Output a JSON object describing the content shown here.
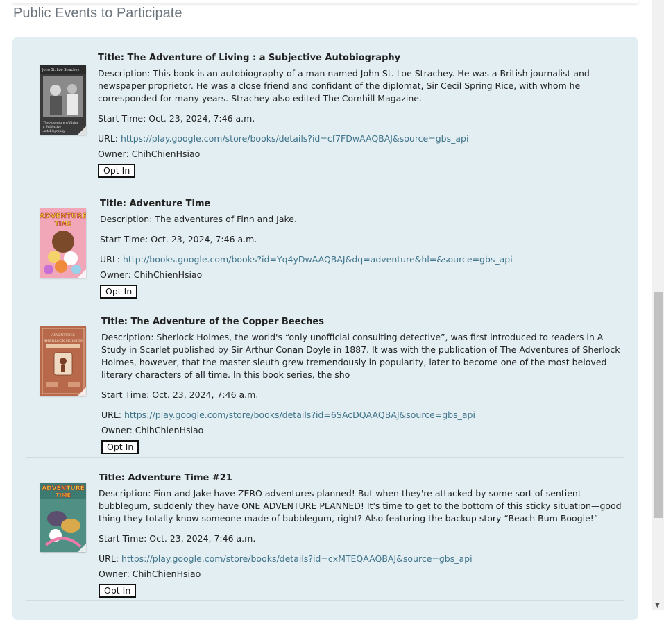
{
  "heading": "Public Events to Participate",
  "labels": {
    "title_prefix": "Title: ",
    "desc_prefix": "Description: ",
    "start_prefix": "Start Time: ",
    "url_prefix": "URL: ",
    "owner_prefix": "Owner: "
  },
  "events": [
    {
      "title": "The Adventure of Living : a Subjective Autobiography",
      "description": "This book is an autobiography of a man named John St. Loe Strachey. He was a British journalist and newspaper proprietor. He was a close friend and confidant of the diplomat, Sir Cecil Spring Rice, with whom he corresponded for many years. Strachey also edited The Cornhill Magazine.",
      "start_time": "Oct. 23, 2024, 7:46 a.m.",
      "url": "https://play.google.com/store/books/details?id=cf7FDwAAQBAJ&source=gbs_api",
      "owner": "ChihChienHsiao",
      "button": "Opt In",
      "cover": {
        "text_top": "John St. Loe Strachey",
        "text_bottom": "The Adventure of Living a Subjective Autobiography"
      }
    },
    {
      "title": "Adventure Time",
      "description": "The adventures of Finn and Jake.",
      "start_time": "Oct. 23, 2024, 7:46 a.m.",
      "url": "http://books.google.com/books?id=Yq4yDwAAQBAJ&dq=adventure&hl=&source=gbs_api",
      "owner": "ChihChienHsiao",
      "button": "Opt In",
      "cover": {
        "logo": "ADVENTURE TIME"
      }
    },
    {
      "title": "The Adventure of the Copper Beeches",
      "description": "Sherlock Holmes, the world's “only unofficial consulting detective”, was first introduced to readers in A Study in Scarlet published by Sir Arthur Conan Doyle in 1887. It was with the publication of The Adventures of Sherlock Holmes, however, that the master sleuth grew tremendously in popularity, later to become one of the most beloved literary characters of all time. In this book series, the sho",
      "start_time": "Oct. 23, 2024, 7:46 a.m.",
      "url": "https://play.google.com/store/books/details?id=6SAcDQAAQBAJ&source=gbs_api",
      "owner": "ChihChienHsiao",
      "button": "Opt In",
      "cover": {
        "text_top": "ADVENTURES",
        "text_mid": "SHERLOCK HOLMES"
      }
    },
    {
      "title": "Adventure Time #21",
      "description": "Finn and Jake have ZERO adventures planned! But when they're attacked by some sort of sentient bubblegum, suddenly they have ONE ADVENTURE PLANNED! It's time to get to the bottom of this sticky situation—good thing they totally know someone made of bubblegum, right? Also featuring the backup story “Beach Bum Boogie!”",
      "start_time": "Oct. 23, 2024, 7:46 a.m.",
      "url": "https://play.google.com/store/books/details?id=cxMTEQAAQBAJ&source=gbs_api",
      "owner": "ChihChienHsiao",
      "button": "Opt In",
      "cover": {
        "logo": "ADVENTURE TIME"
      }
    }
  ],
  "colors": {
    "panel": "#e2eef2",
    "link": "#3f7389",
    "heading": "#6c757d"
  }
}
